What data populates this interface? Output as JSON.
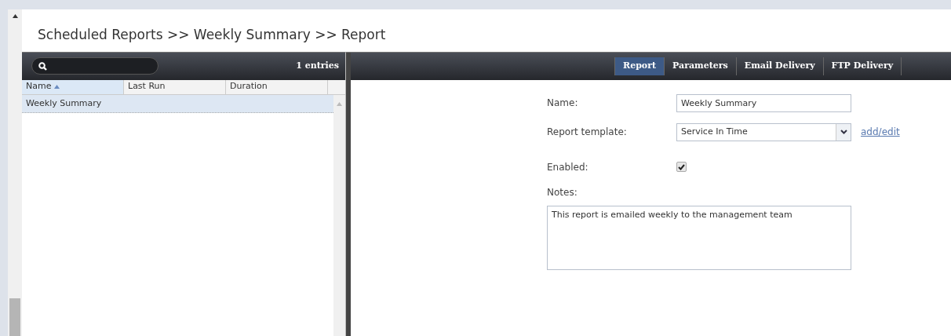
{
  "title": "Scheduled Reports >> Weekly Summary >> Report",
  "list": {
    "entries": "1 entries",
    "columns": [
      {
        "label": "Name",
        "sorted": true
      },
      {
        "label": "Last Run",
        "sorted": false
      },
      {
        "label": "Duration",
        "sorted": false
      }
    ],
    "rows": [
      {
        "name": "Weekly Summary",
        "selected": true
      }
    ]
  },
  "tabs": [
    {
      "label": "Report",
      "selected": true
    },
    {
      "label": "Parameters",
      "selected": false
    },
    {
      "label": "Email Delivery",
      "selected": false
    },
    {
      "label": "FTP Delivery",
      "selected": false
    }
  ],
  "form": {
    "name_label": "Name:",
    "name_value": "Weekly Summary",
    "template_label": "Report template:",
    "template_value": "Service In Time",
    "template_link": "add/edit",
    "enabled_label": "Enabled:",
    "enabled": true,
    "notes_label": "Notes:",
    "notes_value": "This report is emailed weekly to the management team"
  }
}
